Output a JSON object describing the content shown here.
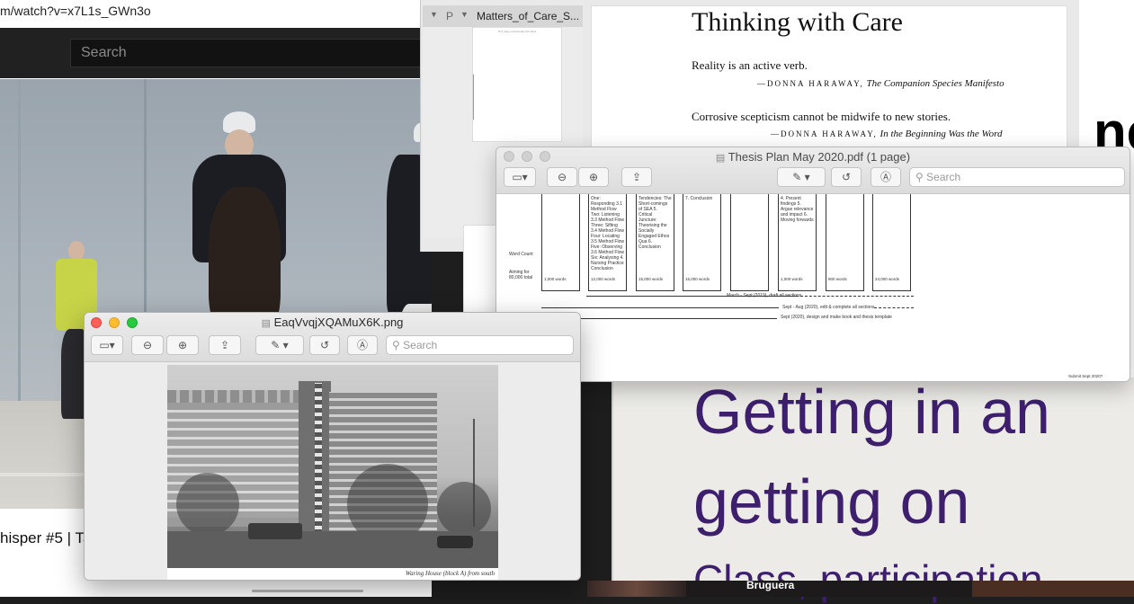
{
  "browser": {
    "url": "m/watch?v=x7L1s_GWn3o",
    "search_placeholder": "Search",
    "video_title": "hisper #5 | Ta"
  },
  "pdf_back": {
    "sidebar_item": "Matters_of_Care_S...",
    "sidebar_prefix": "P",
    "thumb_caption": "This page intentionally left blank",
    "title": "Thinking with Care",
    "quote1": "Reality is an active verb.",
    "attr1_author": "—DONNA HARAWAY,",
    "attr1_work": "The Companion Species Manifesto",
    "quote2": "Corrosive scepticism cannot be midwife to new stories.",
    "attr2_author": "—DONNA HARAWAY,",
    "attr2_work": "In the Beginning Was the Word"
  },
  "thesis_window": {
    "title": "Thesis Plan May 2020.pdf (1 page)",
    "search_placeholder": "Search",
    "row_label": "Word Count",
    "aiming_label": "Aiming for 80,000 total",
    "columns": [
      {
        "text": "",
        "words": "1,000 words"
      },
      {
        "text": "One: Responding 3.1 Method Flow Two: Listening 3.3 Method Flow Three: Sifting 3.4 Method Flow Four: Locating 3.5 Method Flow Five: Observing 3.6 Method Flow Six: Analysing 4. Nursing Practice Conclusion",
        "words": "12,000 words"
      },
      {
        "text": "Tendencies: The Short-comings of SEA 5. Critical Juncture: Theorising the Socially Engaged Ethos Qua 6. Conclusion",
        "words": "15,000 words"
      },
      {
        "text": "7. Conclusion",
        "words": "15,000 words"
      },
      {
        "text": "",
        "words": ""
      },
      {
        "text": "4. Present findings 5. Argue relevance and impact 6. Moving forwards",
        "words": "1,000 words"
      },
      {
        "text": "",
        "words": "900 words"
      },
      {
        "text": "",
        "words": "24,000 words"
      }
    ],
    "timeline1": "March - Sept (2019), draft all sections",
    "timeline2": "Sept - Aug (2020), edit & complete all sections",
    "timeline3": "Sept (2020), design and make book and thesis template",
    "footer": "Submit Sept 2020?"
  },
  "image_window": {
    "title": "EaqVvqjXQAMuX6K.png",
    "search_placeholder": "Search",
    "caption": "Waring House (block A) from south"
  },
  "slide": {
    "line1": "Getting in an",
    "line2": "getting on",
    "line3": "Class, participation",
    "corner_text": "ne",
    "bottom_label": "Bruguera"
  },
  "colors": {
    "slide_text": "#3d1f6e",
    "traffic_red": "#ff5f57",
    "traffic_yellow": "#febc2e",
    "traffic_green": "#28c840",
    "yt_header": "#212121"
  }
}
